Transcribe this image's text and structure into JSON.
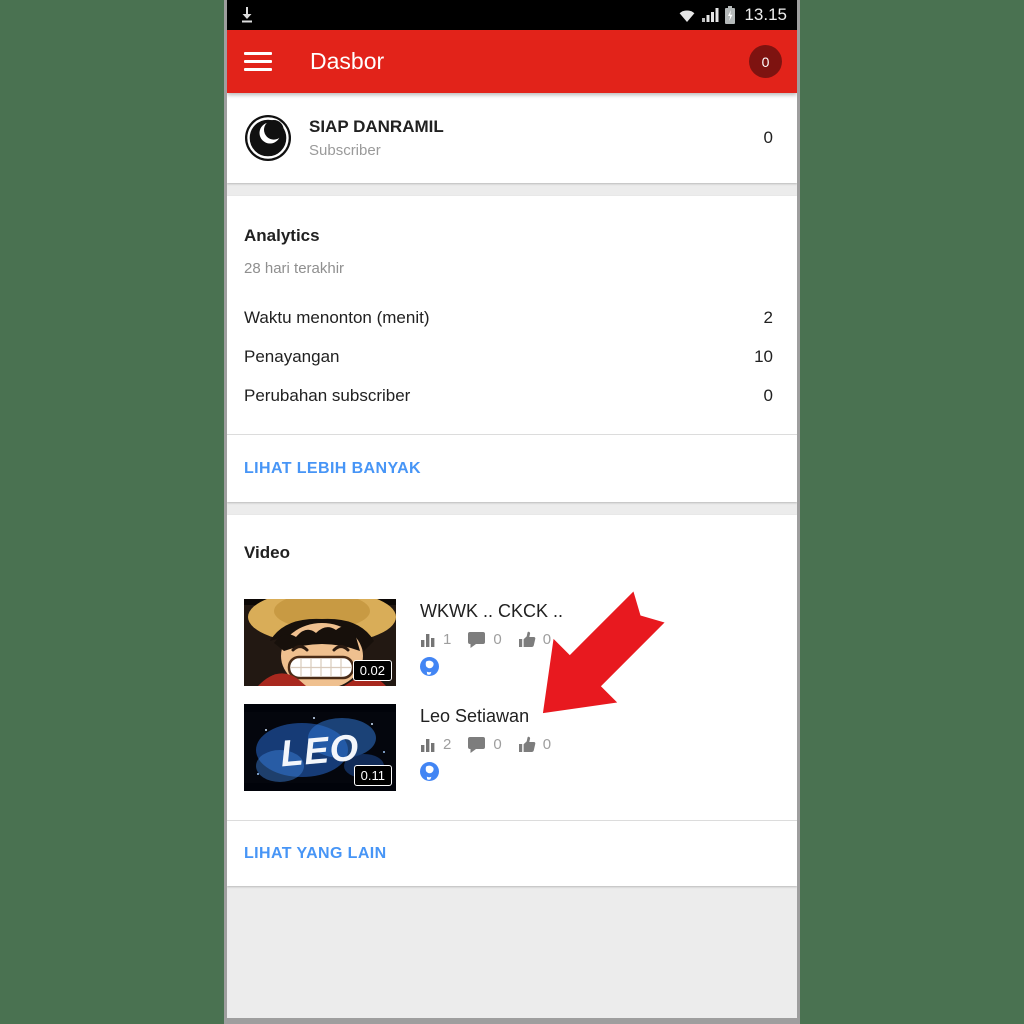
{
  "status_bar": {
    "time": "13.15",
    "icons": [
      "download-icon",
      "wifi-icon",
      "signal-icon",
      "battery-charging-icon"
    ]
  },
  "app_bar": {
    "title": "Dasbor",
    "notification_badge": "0"
  },
  "channel": {
    "name": "SIAP DANRAMIL",
    "label": "Subscriber",
    "subscriber_count": "0"
  },
  "analytics": {
    "title": "Analytics",
    "period": "28 hari terakhir",
    "rows": [
      {
        "label": "Waktu menonton (menit)",
        "value": "2"
      },
      {
        "label": "Penayangan",
        "value": "10"
      },
      {
        "label": "Perubahan subscriber",
        "value": "0"
      }
    ],
    "see_more_label": "LIHAT LEBIH BANYAK"
  },
  "videos": {
    "title": "Video",
    "items": [
      {
        "title": "WKWK .. CKCK ..",
        "duration": "0.02",
        "views": "1",
        "comments": "0",
        "likes": "0",
        "thumbnail": "anime-straw-hat-boy-grinning",
        "thumbnail_text": ""
      },
      {
        "title": "Leo Setiawan",
        "duration": "0.11",
        "views": "2",
        "comments": "0",
        "likes": "0",
        "thumbnail": "blue-galaxy-leo-logo",
        "thumbnail_text": "LEO"
      }
    ],
    "see_more_label": "LIHAT YANG LAIN"
  },
  "annotation": {
    "type": "red-arrow",
    "points_at": "Leo Setiawan"
  },
  "colors": {
    "app_bar_red": "#e2231a",
    "badge_dark_red": "#7e1310",
    "link_blue": "#4795f6",
    "background_green": "#4a7251",
    "arrow_red": "#e8191f",
    "globe_blue": "#4285f4"
  }
}
